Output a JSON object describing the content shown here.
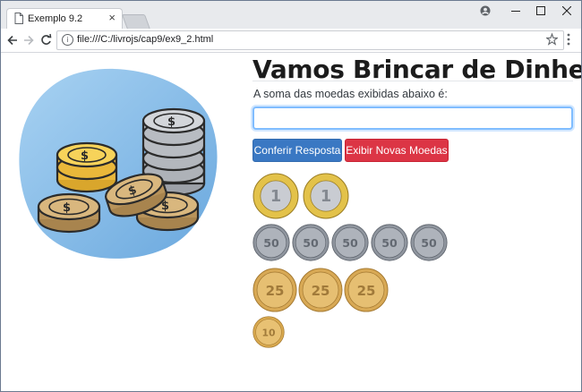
{
  "browser": {
    "tab_title": "Exemplo 9.2",
    "tab_close": "×",
    "url": "file:///C:/livrojs/cap9/ex9_2.html",
    "icons": [
      "page-icon",
      "profile-icon",
      "minimize-icon",
      "maximize-icon",
      "close-icon",
      "back-arrow-icon",
      "forward-arrow-icon",
      "reload-icon",
      "info-icon",
      "star-icon",
      "menu-icon"
    ]
  },
  "page": {
    "heading": "Vamos Brincar de Dinheiro?",
    "instruction": "A soma das moedas exibidas abaixo é:",
    "answer_value": "",
    "check_button": "Conferir Resposta",
    "new_coins_button": "Exibir Novas Moedas"
  },
  "coins": {
    "one_real": {
      "label": "1 REAL",
      "count": 2
    },
    "fifty_centavos": {
      "label": "50 CENTAVOS",
      "count": 5
    },
    "twenty_five_centavos": {
      "label": "25 CENTAVOS",
      "count": 3
    },
    "ten_centavos": {
      "label": "10 CENTAVOS",
      "count": 1
    }
  },
  "colors": {
    "primary": "#3a78c3",
    "danger": "#dc3545",
    "input_focus": "#80bdff",
    "illustration_blue": "#7fb7e6",
    "gold_coin": "#f2c744",
    "silver_coin": "#b8bcc2",
    "bronze_coin": "#cfa76a"
  }
}
